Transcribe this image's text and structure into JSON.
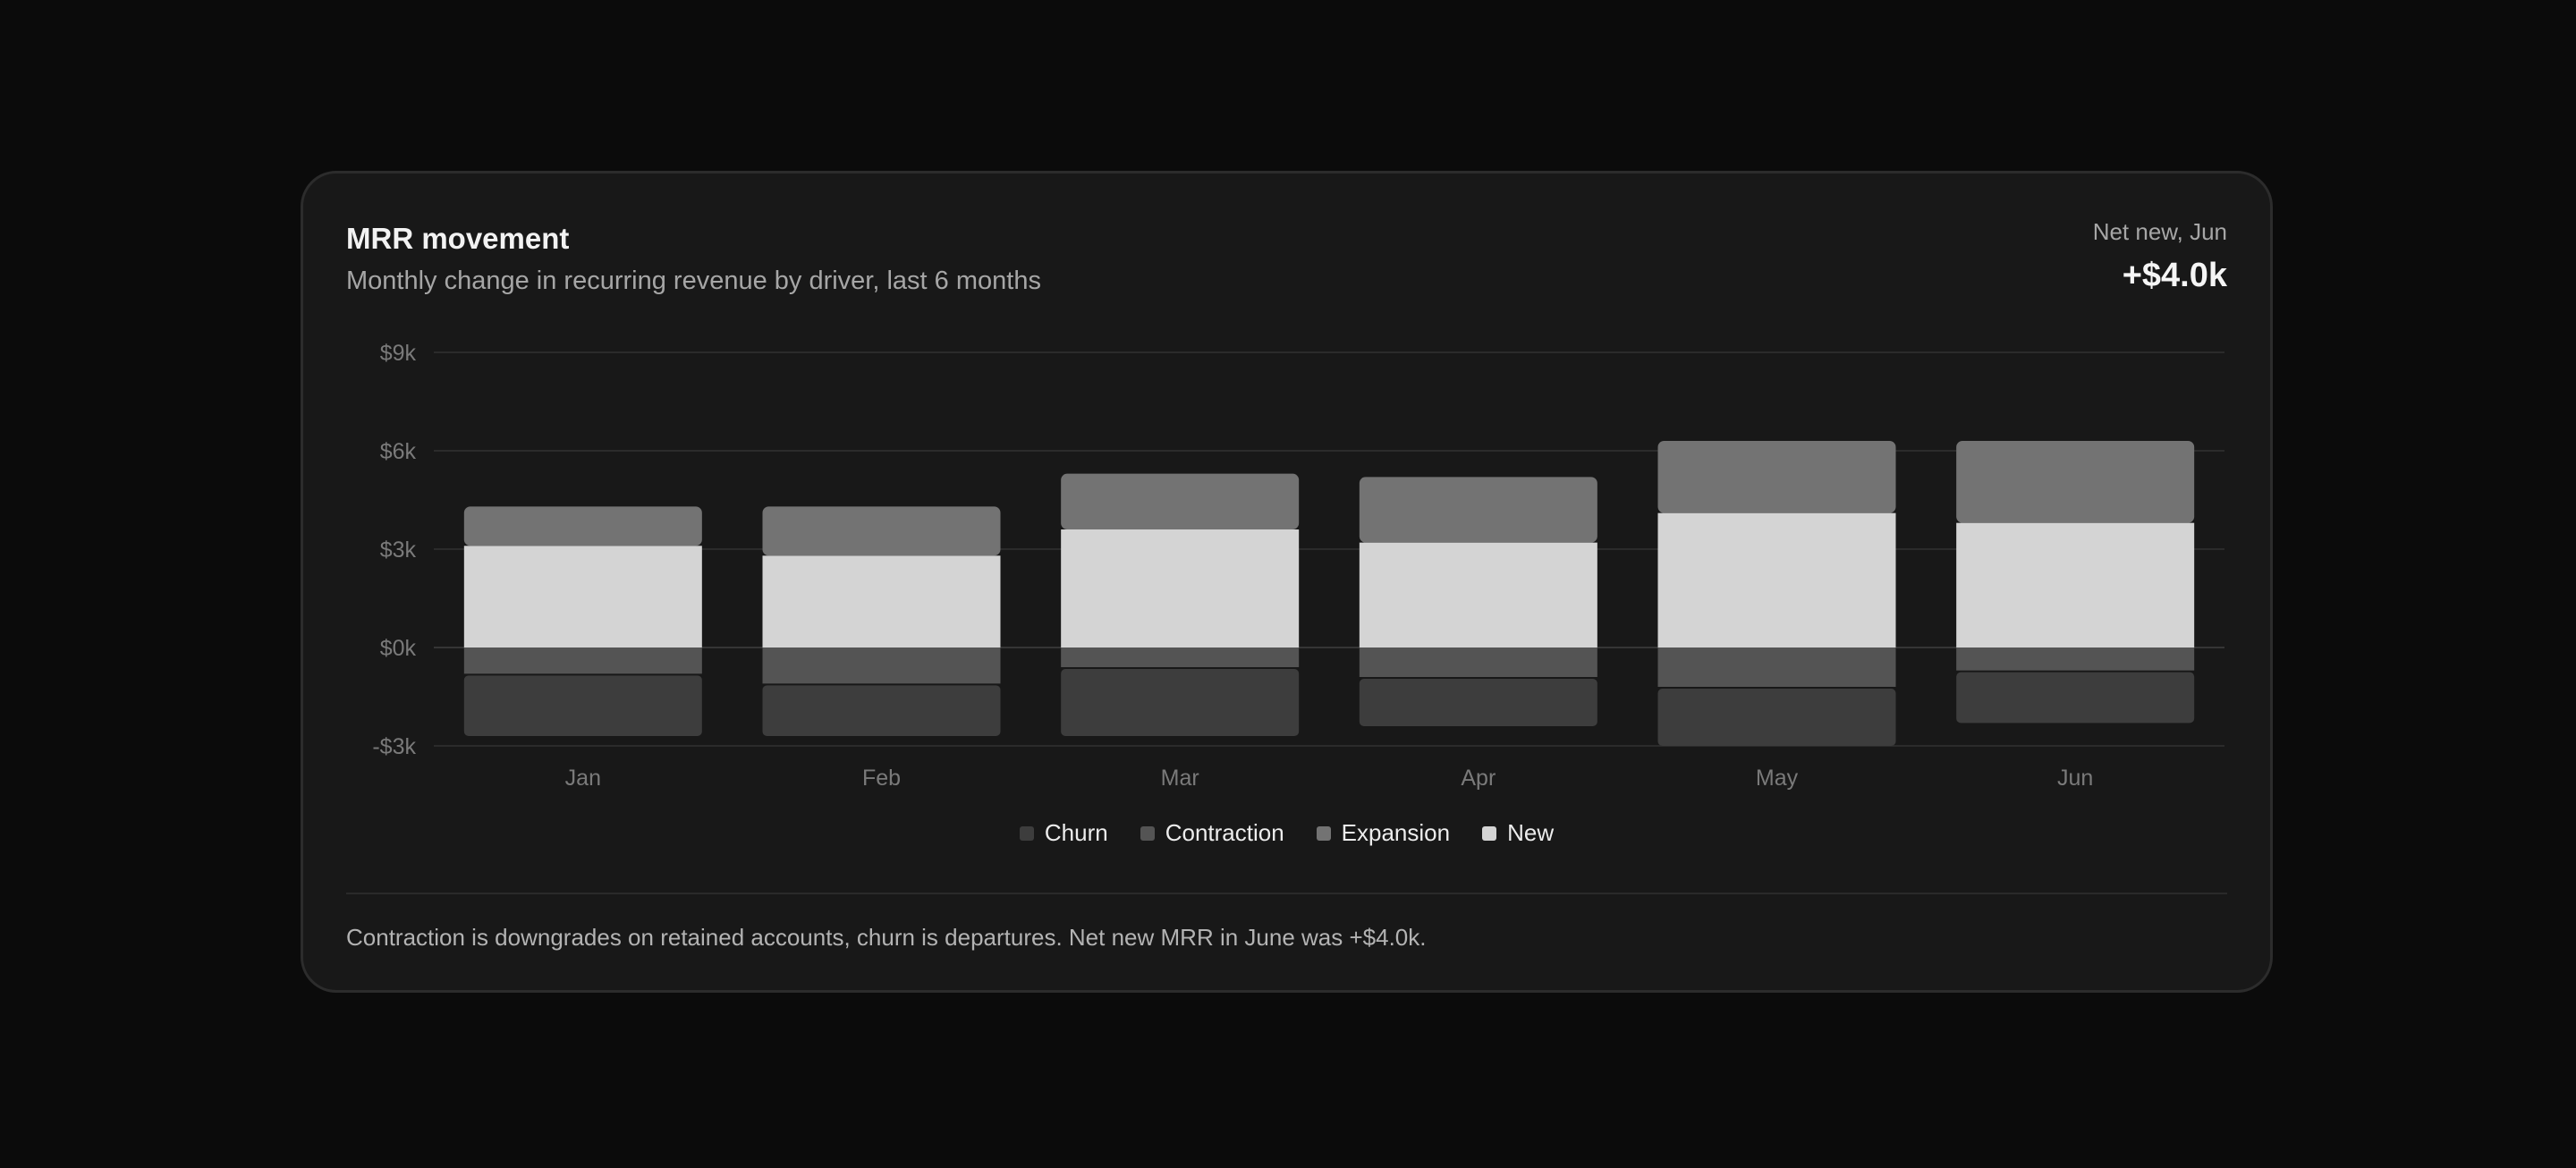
{
  "card": {
    "title": "MRR movement",
    "subtitle": "Monthly change in recurring revenue by driver, last 6 months",
    "kpi_label": "Net new, Jun",
    "kpi_value": "+$4.0k",
    "footnote": "Contraction is downgrades on retained accounts, churn is departures. Net new MRR in June was +$4.0k."
  },
  "colors": {
    "new": "#d4d4d4",
    "expansion": "#737373",
    "contraction": "#545454",
    "churn": "#3d3d3d",
    "grid": "#2b2b2b",
    "tick_text": "#7a7a7a"
  },
  "chart_data": {
    "type": "bar",
    "stacked": true,
    "categories": [
      "Jan",
      "Feb",
      "Mar",
      "Apr",
      "May",
      "Jun"
    ],
    "y_ticks": [
      "$9k",
      "$6k",
      "$3k",
      "$0k",
      "-$3k"
    ],
    "ylim": [
      -3000,
      9000
    ],
    "grid": true,
    "legend_position": "bottom-center",
    "series": [
      {
        "name": "Churn",
        "key": "churn",
        "values": [
          -1900,
          -1600,
          -2100,
          -1500,
          -1800,
          -1600
        ]
      },
      {
        "name": "Contraction",
        "key": "contraction",
        "values": [
          -800,
          -1100,
          -600,
          -900,
          -1200,
          -700
        ]
      },
      {
        "name": "Expansion",
        "key": "expansion",
        "values": [
          1200,
          1500,
          1700,
          2000,
          2200,
          2500
        ]
      },
      {
        "name": "New",
        "key": "new",
        "values": [
          3100,
          2800,
          3600,
          3200,
          4100,
          3800
        ]
      }
    ],
    "xlabel": "",
    "ylabel": ""
  }
}
